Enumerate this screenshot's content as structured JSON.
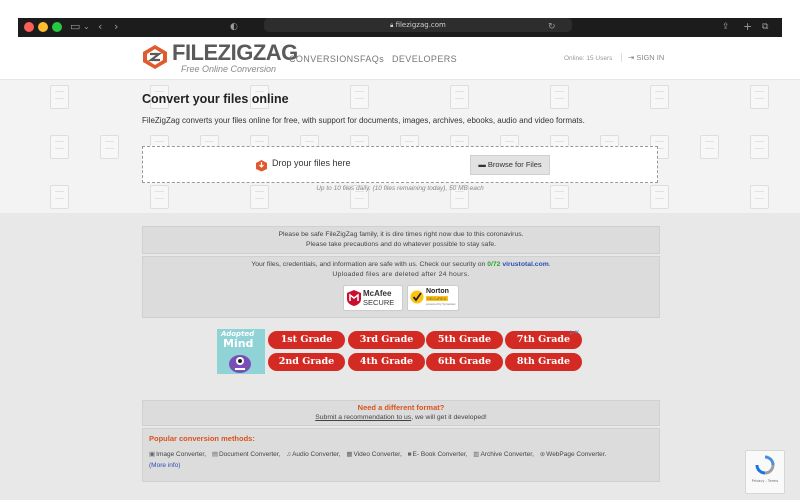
{
  "browser": {
    "url": "filezigzag.com"
  },
  "header": {
    "logo_main": "FILEZIGZAG",
    "logo_sub": "Free Online Conversion",
    "nav": [
      {
        "label": "CONVERSIONS"
      },
      {
        "label": "FAQs"
      },
      {
        "label": "DEVELOPERS"
      }
    ],
    "online_users": "Online: 15 Users",
    "signin": "SIGN IN"
  },
  "hero": {
    "title": "Convert your files online",
    "description": "FileZigZag converts your files online for free, with support for documents, images, archives, ebooks, audio and video formats.",
    "drop_text": "Drop your files here",
    "browse_label": "Browse for Files",
    "limit_note": "Up to 10 files daily. (10 files remaining today), 50 MB each"
  },
  "notice": {
    "line1": "Please be safe FileZigZag family, it is dire times right now due to this coronavirus.",
    "line2": "Please take precautions and do whatever possible to stay safe."
  },
  "security": {
    "line1_pre": "Your files, credentials, and information are safe with us. Check our security on ",
    "score": "0/72",
    "site": "virustotal.com",
    "line1_post": ".",
    "line2": "Uploaded files are deleted after 24 hours.",
    "badges": [
      {
        "name": "McAfee",
        "sub": "SECURE"
      },
      {
        "name": "Norton",
        "sub": "SECURED",
        "by": "powered by Symantec"
      }
    ]
  },
  "ad": {
    "brand_line1": "Adopted",
    "brand_line2": "Mind",
    "grades": [
      "1st Grade",
      "3rd Grade",
      "5th Grade",
      "7th Grade",
      "2nd Grade",
      "4th Grade",
      "6th Grade",
      "8th Grade"
    ],
    "ad_choice": "▷✕"
  },
  "need_format": {
    "title": "Need a different format?",
    "text_link": "Submit a recommendation to us",
    "text_rest": ", we will get it developed!"
  },
  "popular": {
    "title": "Popular conversion methods:",
    "items": [
      {
        "icon": "image-icon",
        "label": "Image Converter,"
      },
      {
        "icon": "document-icon",
        "label": "Document Converter,"
      },
      {
        "icon": "music-icon",
        "label": "Audio Converter,"
      },
      {
        "icon": "film-icon",
        "label": "Video Converter,"
      },
      {
        "icon": "book-icon",
        "label": "E- Book Converter,"
      },
      {
        "icon": "archive-icon",
        "label": "Archive Converter,"
      },
      {
        "icon": "globe-icon",
        "label": "WebPage Converter."
      }
    ],
    "more_info": "(More info)"
  },
  "recaptcha": {
    "text": "Privacy - Terms"
  },
  "colors": {
    "accent_orange": "#e05a2b",
    "grade_red": "#d42a24",
    "score_green": "#2aa72a",
    "link_blue": "#2c4fb3"
  }
}
